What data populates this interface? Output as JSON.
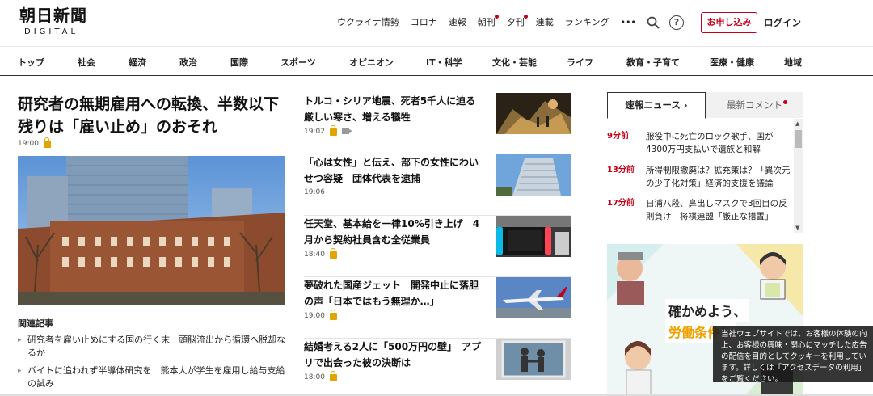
{
  "logo": {
    "main": "朝日新聞",
    "sub": "DIGITAL"
  },
  "topnav": [
    {
      "label": "ウクライナ情勢",
      "dot": false
    },
    {
      "label": "コロナ",
      "dot": false
    },
    {
      "label": "速報",
      "dot": false
    },
    {
      "label": "朝刊",
      "dot": true
    },
    {
      "label": "夕刊",
      "dot": true
    },
    {
      "label": "連載",
      "dot": false
    },
    {
      "label": "ランキング",
      "dot": false
    },
    {
      "label": "•••",
      "dot": false
    }
  ],
  "header": {
    "help": "?",
    "subscribe": "お申し込み",
    "login": "ログイン"
  },
  "categories": [
    "トップ",
    "社会",
    "経済",
    "政治",
    "国際",
    "スポーツ",
    "オピニオン",
    "IT・科学",
    "文化・芸能",
    "ライフ",
    "教育・子育て",
    "医療・健康",
    "地域"
  ],
  "lead": {
    "title": "研究者の無期雇用への転換、半数以下残りは「雇い止め」のおそれ",
    "time": "19:00",
    "related_head": "関連記事",
    "related": [
      "研究者を雇い止めにする国の行く末　頭脳流出から循環へ脱却なるか",
      "バイトに追われず半導体研究を　熊本大が学生を雇用し給与支給の試み"
    ]
  },
  "mid": [
    {
      "title": "トルコ・シリア地震、死者5千人に迫る　厳しい寒さ、増える犠牲",
      "time": "19:02",
      "video": true
    },
    {
      "title": "「心は女性」と伝え、部下の女性にわいせつ容疑　団体代表を逮捕",
      "time": "19:06",
      "video": false
    },
    {
      "title": "任天堂、基本給を一律10%引き上げ　4月から契約社員含む全従業員",
      "time": "18:40",
      "video": false
    },
    {
      "title": "夢破れた国産ジェット　開発中止に落胆の声「日本ではもう無理か…」",
      "time": "19:00",
      "video": false
    },
    {
      "title": "結婚考える2人に「500万円の壁」　アプリで出会った彼の決断は",
      "time": "18:00",
      "video": false
    }
  ],
  "tabs": {
    "active": "速報ニュース",
    "active_arrow": "›",
    "inactive": "最新コメント"
  },
  "breaking": [
    {
      "time": "9分前",
      "text": "服役中に死亡のロック歌手、国が4300万円支払いで遺族と和解"
    },
    {
      "time": "13分前",
      "text": "所得制限撤廃は？拡充策は？「異次元の少子化対策」経済的支援を議論"
    },
    {
      "time": "17分前",
      "text": "日浦八段、鼻出しマスクで3回目の反則負け　将棋連盟「厳正な措置」"
    }
  ],
  "ad": {
    "line1": "確かめよう、",
    "line2": "労働条件！"
  },
  "cookie": {
    "text": "当社ウェブサイトでは、お客様の体験の向上、お客様の興味・関心にマッチした広告の配信を目的としてクッキーを利用しています。詳しくは「アクセスデータの利用」をご覧ください。"
  },
  "colors": {
    "accent": "#c4001a",
    "lock": "#e1a400"
  }
}
